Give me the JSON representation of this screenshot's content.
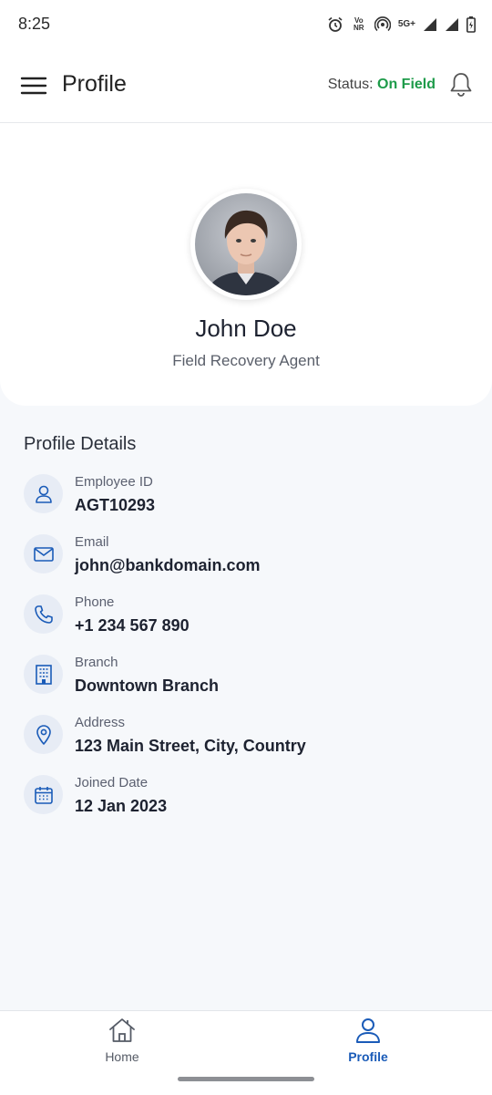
{
  "status_bar": {
    "time": "8:25",
    "volte_top": "Vo",
    "volte_bottom": "NR",
    "network": "5G+"
  },
  "header": {
    "title": "Profile",
    "status_label": "Status:",
    "status_value": "On Field",
    "status_color": "#1e9b4a"
  },
  "profile": {
    "name": "John Doe",
    "role": "Field Recovery Agent"
  },
  "details": {
    "title": "Profile Details",
    "items": [
      {
        "label": "Employee ID",
        "value": "AGT10293",
        "icon": "user-icon"
      },
      {
        "label": "Email",
        "value": "john@bankdomain.com",
        "icon": "mail-icon"
      },
      {
        "label": "Phone",
        "value": "+1 234 567 890",
        "icon": "phone-icon"
      },
      {
        "label": "Branch",
        "value": "Downtown Branch",
        "icon": "building-icon"
      },
      {
        "label": "Address",
        "value": "123 Main Street, City, Country",
        "icon": "map-pin-icon"
      },
      {
        "label": "Joined Date",
        "value": "12 Jan 2023",
        "icon": "calendar-icon"
      }
    ]
  },
  "nav": {
    "home_label": "Home",
    "profile_label": "Profile",
    "active": "Profile",
    "accent_color": "#1a5bb8"
  }
}
